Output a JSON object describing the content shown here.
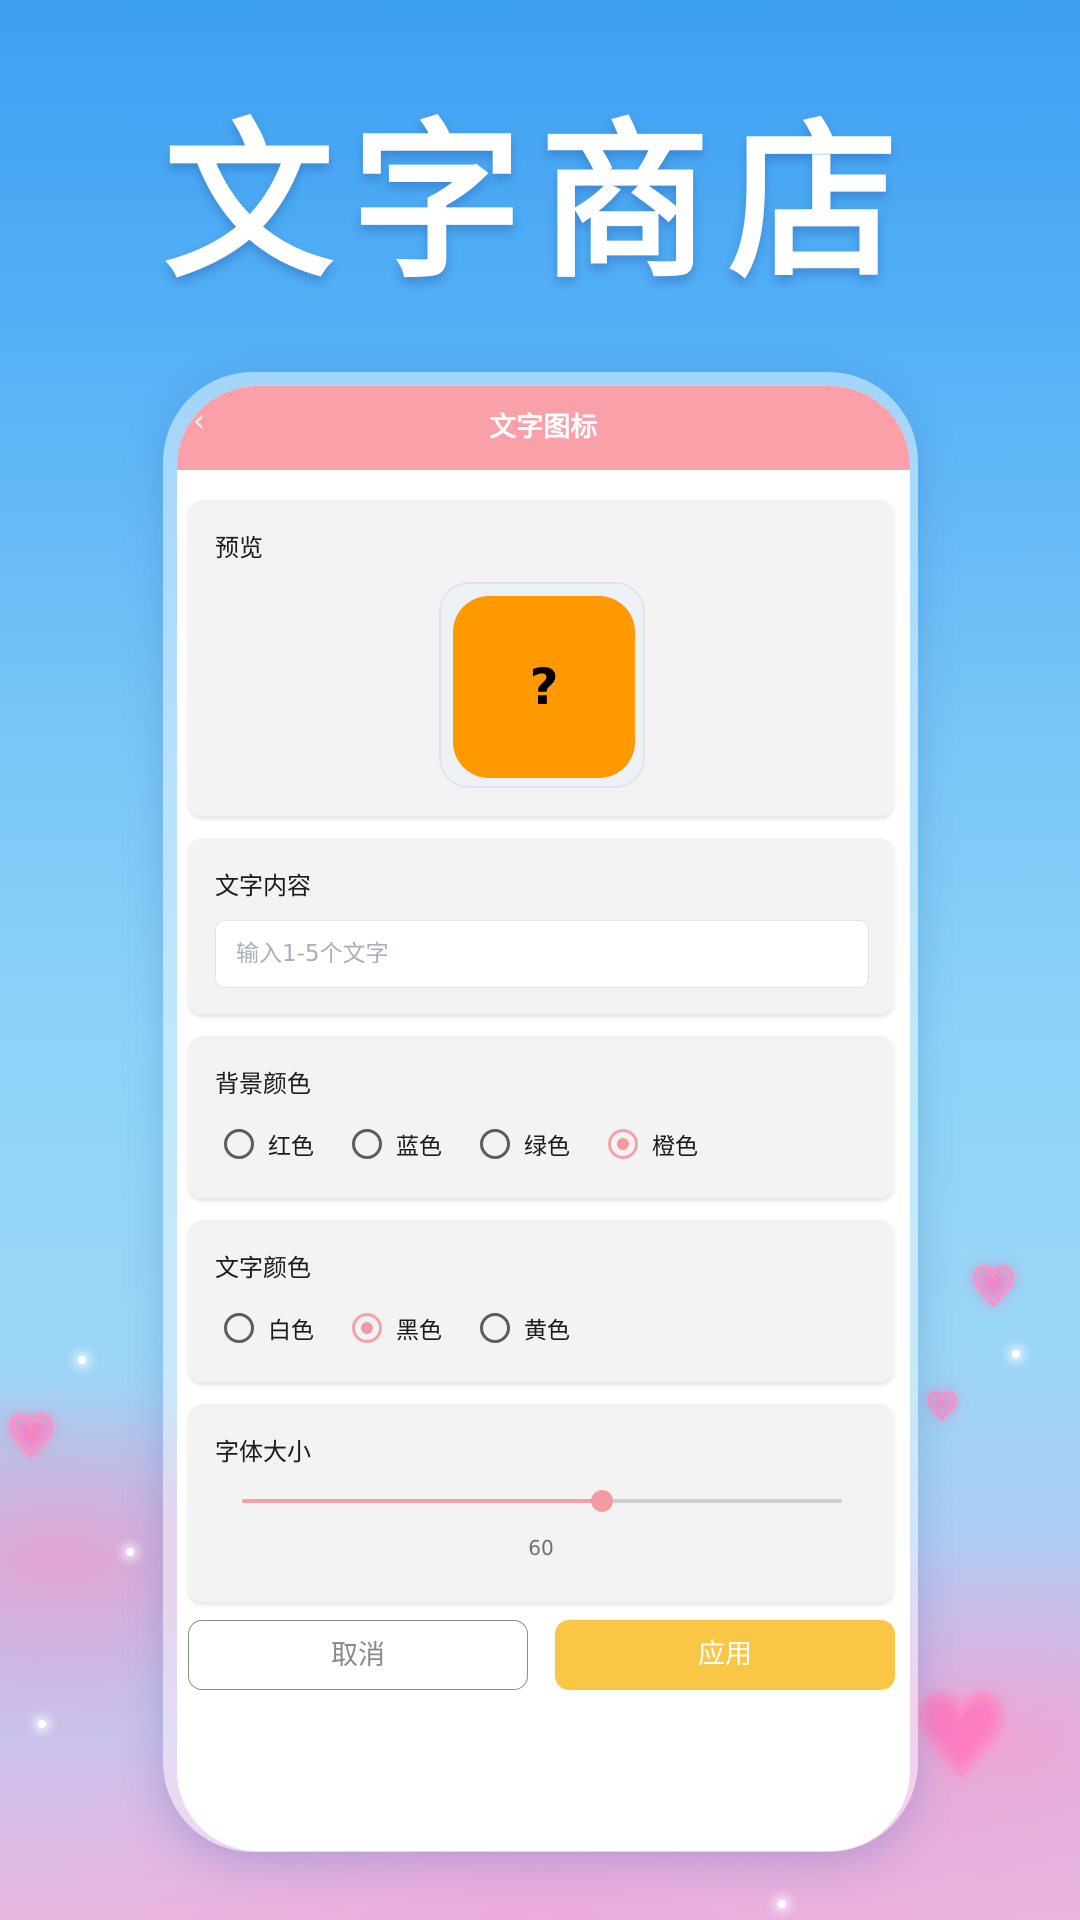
{
  "hero": {
    "title": "文字商店"
  },
  "appbar": {
    "back_icon": "chevron-left-icon",
    "title": "文字图标"
  },
  "preview": {
    "label": "预览",
    "icon_text": "?",
    "icon_bg": "#fe9901",
    "icon_text_color": "#000000"
  },
  "text_content": {
    "label": "文字内容",
    "value": "",
    "placeholder": "输入1-5个文字"
  },
  "background_color": {
    "label": "背景颜色",
    "options": [
      "红色",
      "蓝色",
      "绿色",
      "橙色"
    ],
    "selected": "橙色"
  },
  "text_color": {
    "label": "文字颜色",
    "options": [
      "白色",
      "黑色",
      "黄色"
    ],
    "selected": "黑色"
  },
  "font_size": {
    "label": "字体大小",
    "value": "60",
    "fraction": 0.6
  },
  "actions": {
    "cancel": "取消",
    "apply": "应用"
  },
  "colors": {
    "appbar": "#f9a0a8",
    "accent": "#f69aa2",
    "apply_button": "#f9c646",
    "card_bg": "#f3f3f3"
  }
}
